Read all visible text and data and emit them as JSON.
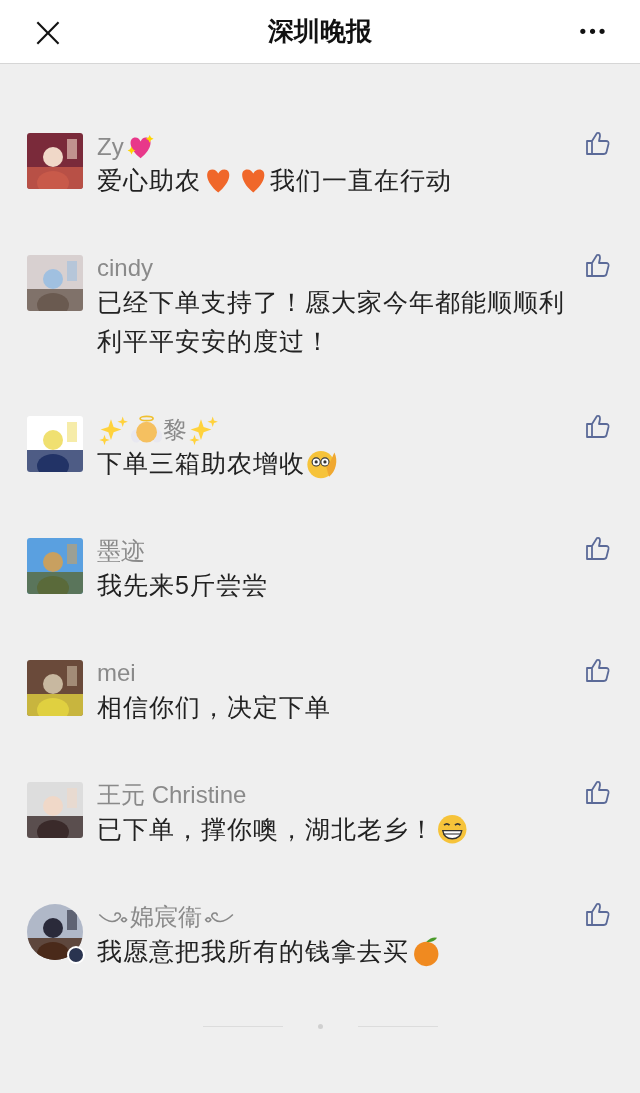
{
  "header": {
    "close": "×",
    "title": "深圳晚报",
    "more": "•••"
  },
  "comments": [
    {
      "avatar": {
        "kind": "picture",
        "round": false
      },
      "name": [
        {
          "kind": "text",
          "text": "Zy"
        },
        {
          "kind": "sparkleheart"
        }
      ],
      "text": [
        {
          "kind": "text",
          "text": "爱心助农"
        },
        {
          "kind": "heart"
        },
        {
          "kind": "heart"
        },
        {
          "kind": "text",
          "text": "我们一直在行动"
        }
      ]
    },
    {
      "avatar": {
        "kind": "picture",
        "round": false
      },
      "name": [
        {
          "kind": "text",
          "text": "cindy"
        }
      ],
      "text": [
        {
          "kind": "text",
          "text": "已经下单支持了！愿大家今年都能顺顺利利平平安安的度过！"
        }
      ]
    },
    {
      "avatar": {
        "kind": "picture",
        "round": false
      },
      "name": [
        {
          "kind": "sparkles"
        },
        {
          "kind": "angel"
        },
        {
          "kind": "text",
          "text": "黎"
        },
        {
          "kind": "sparkles"
        }
      ],
      "text": [
        {
          "kind": "text",
          "text": "下单三箱助农增收"
        },
        {
          "kind": "salute"
        }
      ]
    },
    {
      "avatar": {
        "kind": "picture",
        "round": false
      },
      "name": [
        {
          "kind": "text",
          "text": "墨迹"
        }
      ],
      "text": [
        {
          "kind": "text",
          "text": "我先来5斤尝尝"
        }
      ]
    },
    {
      "avatar": {
        "kind": "picture",
        "round": false
      },
      "name": [
        {
          "kind": "text",
          "text": "mei"
        }
      ],
      "text": [
        {
          "kind": "text",
          "text": "相信你们，决定下单"
        }
      ]
    },
    {
      "avatar": {
        "kind": "picture",
        "round": false
      },
      "name": [
        {
          "kind": "text",
          "text": "王元 Christine"
        }
      ],
      "text": [
        {
          "kind": "text",
          "text": "已下单，撑你噢，湖北老乡！"
        },
        {
          "kind": "grin"
        }
      ]
    },
    {
      "avatar": {
        "kind": "picture",
        "round": true
      },
      "name": [
        {
          "kind": "swirlleft"
        },
        {
          "kind": "text",
          "text": "婂宸衞"
        },
        {
          "kind": "swirlright"
        }
      ],
      "text": [
        {
          "kind": "text",
          "text": "我愿意把我所有的钱拿去买"
        },
        {
          "kind": "tangerine"
        }
      ]
    }
  ]
}
